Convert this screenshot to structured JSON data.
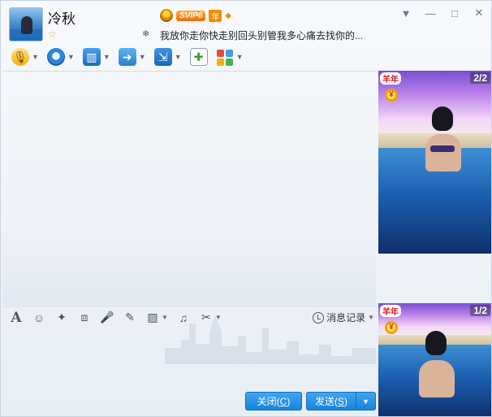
{
  "contact": {
    "nickname": "冷秋",
    "vip_label": "SVIP6",
    "year_label": "年",
    "signature": "我放你走你快走别回头别管我多心痛去找你的..."
  },
  "toolbar": {
    "items": [
      {
        "name": "voice-call",
        "icon": "microphone-icon"
      },
      {
        "name": "video-call",
        "icon": "webcam-icon"
      },
      {
        "name": "screen-share",
        "icon": "presentation-icon"
      },
      {
        "name": "file-transfer",
        "icon": "folder-arrow-icon"
      },
      {
        "name": "remote-desktop",
        "icon": "remote-screen-icon"
      },
      {
        "name": "new-chat",
        "icon": "chat-add-icon"
      },
      {
        "name": "apps",
        "icon": "apps-grid-icon"
      }
    ]
  },
  "photos": {
    "top_counter": "2/2",
    "bottom_counter": "1/2",
    "year_logo": "羊年"
  },
  "format_bar": {
    "history_label": "消息记录"
  },
  "buttons": {
    "close_label": "关闭(",
    "close_key": "C",
    "close_suffix": ")",
    "send_label": "发送(",
    "send_key": "S",
    "send_suffix": ")"
  },
  "colors": {
    "accent": "#1683db",
    "background": "#eef2f7"
  }
}
